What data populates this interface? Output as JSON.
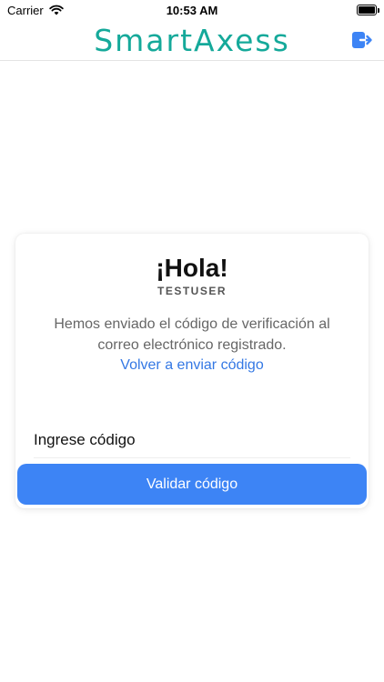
{
  "status_bar": {
    "carrier": "Carrier",
    "time": "10:53 AM"
  },
  "header": {
    "logo_text": "SmartAxess",
    "logo_color": "#15a99a",
    "logout_icon": "logout-icon"
  },
  "card": {
    "greeting": "¡Hola!",
    "username": "TESTUSER",
    "message": "Hemos enviado el código de verificación al correo electrónico registrado.",
    "resend_link": "Volver a enviar código",
    "code_input_placeholder": "Ingrese código",
    "code_input_value": "",
    "validate_button": "Validar código"
  },
  "colors": {
    "accent": "#3d84f5",
    "link": "#3478e4"
  }
}
